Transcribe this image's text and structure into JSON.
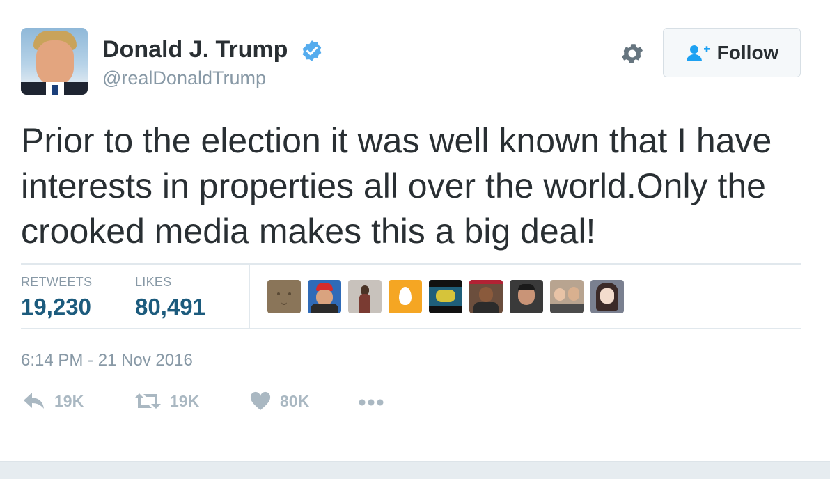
{
  "author": {
    "name": "Donald J. Trump",
    "handle": "@realDonaldTrump",
    "avatar_icon": "profile-photo",
    "verified_icon": "verified-badge-icon",
    "verified_color": "#55acee"
  },
  "header": {
    "settings_icon": "gear-icon",
    "follow_label": "Follow",
    "follow_icon": "add-user-icon",
    "follow_icon_color": "#1da1f2"
  },
  "tweet": {
    "lines": [
      "Prior to the election it was well known that I have",
      "interests in properties all over the world.Only the",
      "crooked media makes this a big deal!"
    ]
  },
  "stats": {
    "retweets_label": "RETWEETS",
    "retweets_value": "19,230",
    "likes_label": "LIKES",
    "likes_value": "80,491"
  },
  "liked_by": [
    {
      "kind": "cardboard-face-avatar",
      "color": "#8a7559"
    },
    {
      "kind": "man-in-red-cap-avatar",
      "color": "#2f6bb8"
    },
    {
      "kind": "woman-figure-avatar",
      "color": "#c8c2bc"
    },
    {
      "kind": "egg-avatar",
      "color": "#f5a623"
    },
    {
      "kind": "cartoon-avatar",
      "color": "#1f5f7a"
    },
    {
      "kind": "person-flag-avatar",
      "color": "#6b4e3d"
    },
    {
      "kind": "man-portrait-avatar",
      "color": "#3a3a3a"
    },
    {
      "kind": "couple-selfie-avatar",
      "color": "#b8a490"
    },
    {
      "kind": "anime-girl-avatar",
      "color": "#7a8090"
    }
  ],
  "timestamp": "6:14 PM - 21 Nov 2016",
  "actions": {
    "reply_icon": "reply-icon",
    "reply_count": "19K",
    "retweet_icon": "retweet-icon",
    "retweet_count": "19K",
    "like_icon": "heart-icon",
    "like_count": "80K",
    "more_icon": "more-icon",
    "icon_color": "#aab8c2"
  },
  "colors": {
    "text": "#292f33",
    "muted": "#8899a6",
    "stat_value": "#1c5b7d",
    "divider": "#e1e8ed"
  }
}
